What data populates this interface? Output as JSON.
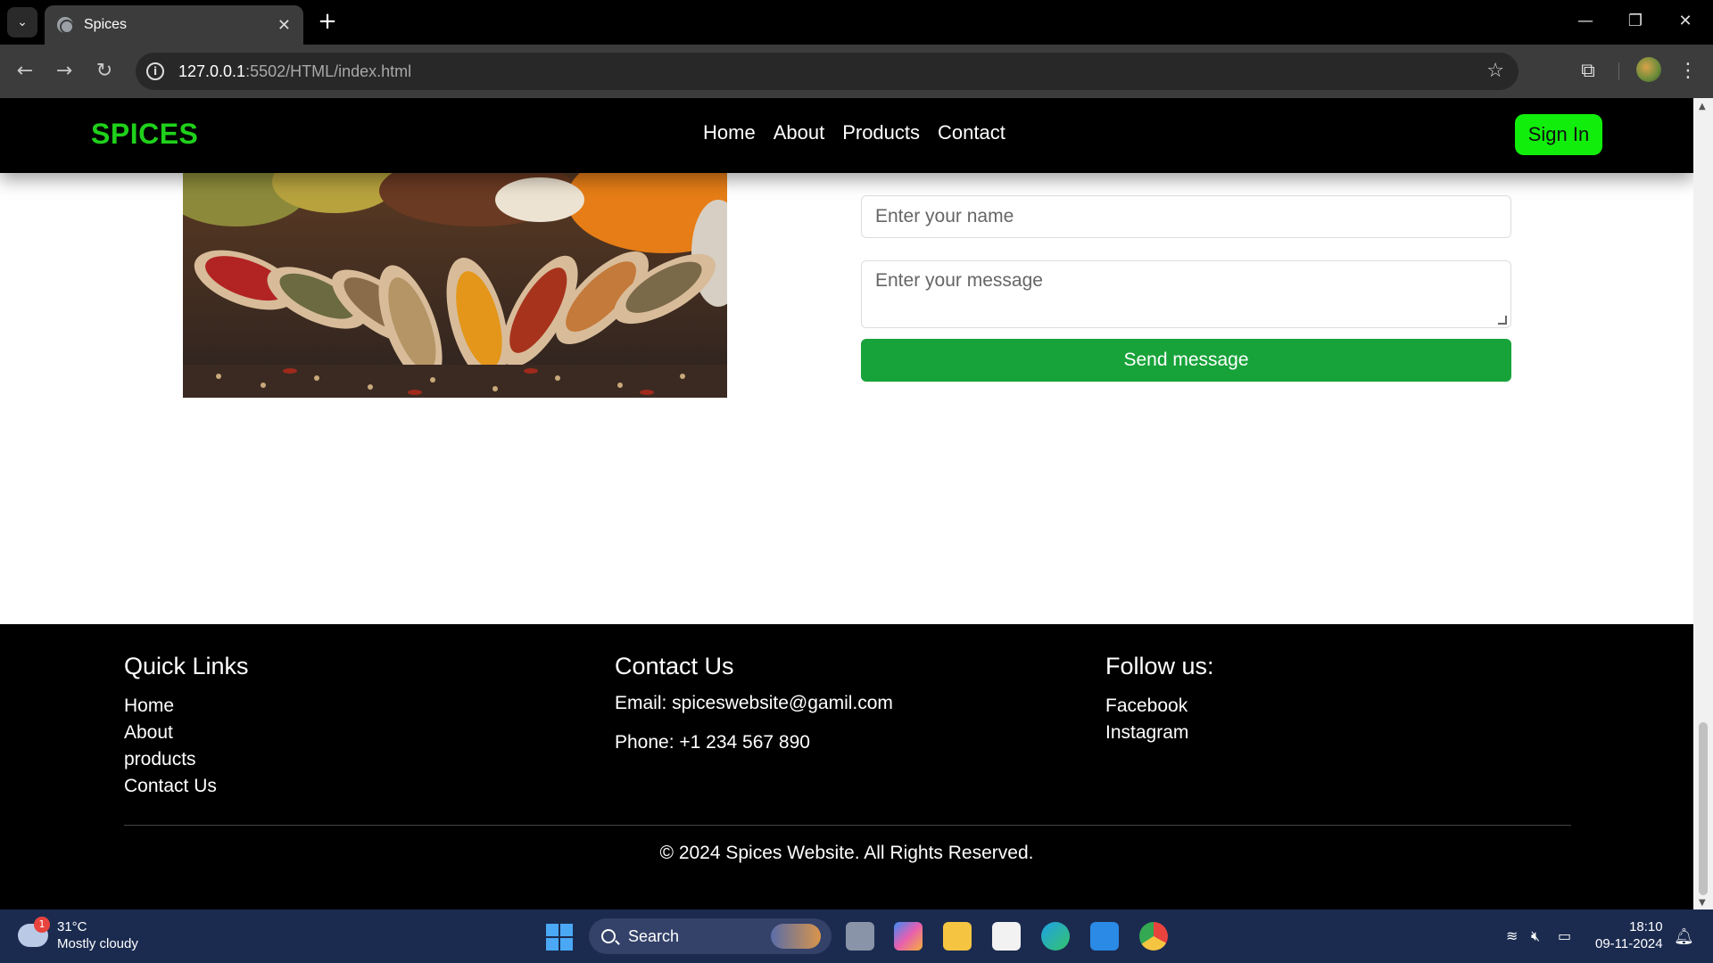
{
  "browser": {
    "tab_title": "Spices",
    "url_host": "127.0.0.1",
    "url_rest": ":5502/HTML/index.html"
  },
  "site": {
    "logo": "SPICES",
    "nav": [
      "Home",
      "About",
      "Products",
      "Contact"
    ],
    "signin": "Sign In",
    "accent_color": "#1fd11a"
  },
  "form": {
    "name_placeholder": "Enter your name",
    "message_placeholder": "Enter your message",
    "send_label": "Send message"
  },
  "footer": {
    "quick_links_title": "Quick Links",
    "quick_links": [
      "Home",
      "About",
      "products",
      "Contact Us"
    ],
    "contact_title": "Contact Us",
    "email": "Email: spiceswebsite@gamil.com",
    "phone": "Phone: +1 234 567 890",
    "follow_title": "Follow us:",
    "follow_links": [
      "Facebook",
      "Instagram"
    ],
    "copyright": "© 2024 Spices Website. All Rights Reserved."
  },
  "taskbar": {
    "weather_badge": "1",
    "temperature": "31°C",
    "weather": "Mostly cloudy",
    "search": "Search",
    "time": "18:10",
    "date": "09-11-2024"
  }
}
